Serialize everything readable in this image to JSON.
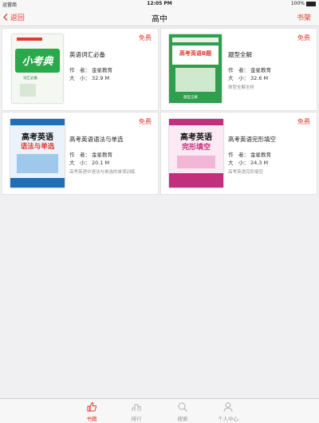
{
  "status_bar": {
    "carrier": "运营商",
    "time": "12:05 PM",
    "battery": "100%"
  },
  "nav": {
    "back": "返回",
    "title": "高中",
    "shelf": "书架"
  },
  "books": [
    {
      "title": "英语词汇必备",
      "author_label": "作　者：",
      "author": "金星教育",
      "size_label": "大　小：",
      "size": "32.9 M",
      "desc": "",
      "badge": "免费"
    },
    {
      "title": "题型全解",
      "author_label": "作　者：",
      "author": "金星教育",
      "size_label": "大　小：",
      "size": "32.6 M",
      "desc": "体型全解全析",
      "badge": "免费"
    },
    {
      "title": "高考英语语法与单选",
      "author_label": "作　者：",
      "author": "金星教育",
      "size_label": "大　小：",
      "size": "20.1 M",
      "desc": "高考英语中语法与单选的单项训练",
      "badge": "免费"
    },
    {
      "title": "高考英语完形填空",
      "author_label": "作　者：",
      "author": "金星教育",
      "size_label": "大　小：",
      "size": "24.3 M",
      "desc": "高考英语完形填空",
      "badge": "免费"
    }
  ],
  "covers": [
    {
      "big_text": "小考典",
      "sub": "词汇必备"
    },
    {
      "big_text": "高考英语B题",
      "sub": "题型全解"
    },
    {
      "big_text": "高考英语",
      "big_text2": "语法与单选"
    },
    {
      "big_text": "高考英语",
      "big_text2": "完形填空"
    }
  ],
  "tabs": [
    {
      "label": "书籍",
      "icon": "thumbs-up-icon"
    },
    {
      "label": "排行",
      "icon": "ranking-icon"
    },
    {
      "label": "搜索",
      "icon": "search-icon"
    },
    {
      "label": "个人中心",
      "icon": "person-icon"
    }
  ],
  "colors": {
    "accent": "#e7382f"
  }
}
